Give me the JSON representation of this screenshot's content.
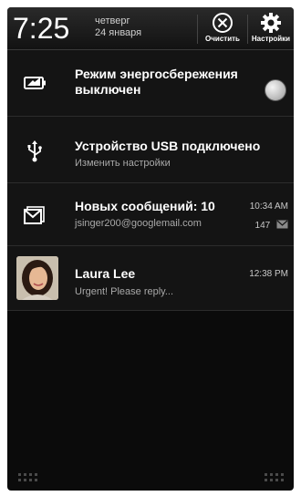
{
  "header": {
    "time": "7:25",
    "day": "четверг",
    "date": "24 января",
    "clear_label": "Очистить",
    "settings_label": "Настройки"
  },
  "notifications": [
    {
      "icon": "battery-saver-icon",
      "title": "Режим энергосбережения выключен",
      "title_line1": "Режим энергосбережения",
      "title_line2": "выключен"
    },
    {
      "icon": "usb-icon",
      "title": "Устройство USB подключено",
      "subtitle": "Изменить настройки"
    },
    {
      "icon": "gmail-icon",
      "title": "Новых сообщений: 10",
      "subtitle": "jsinger200@googlemail.com",
      "time": "10:34 AM",
      "count": "147"
    },
    {
      "icon": "contact-avatar",
      "title": "Laura Lee",
      "subtitle": "Urgent! Please reply...",
      "time": "12:38 PM"
    }
  ],
  "colors": {
    "background": "#0b0b0b",
    "row": "#141414",
    "secondary_text": "#a9a9a9"
  }
}
